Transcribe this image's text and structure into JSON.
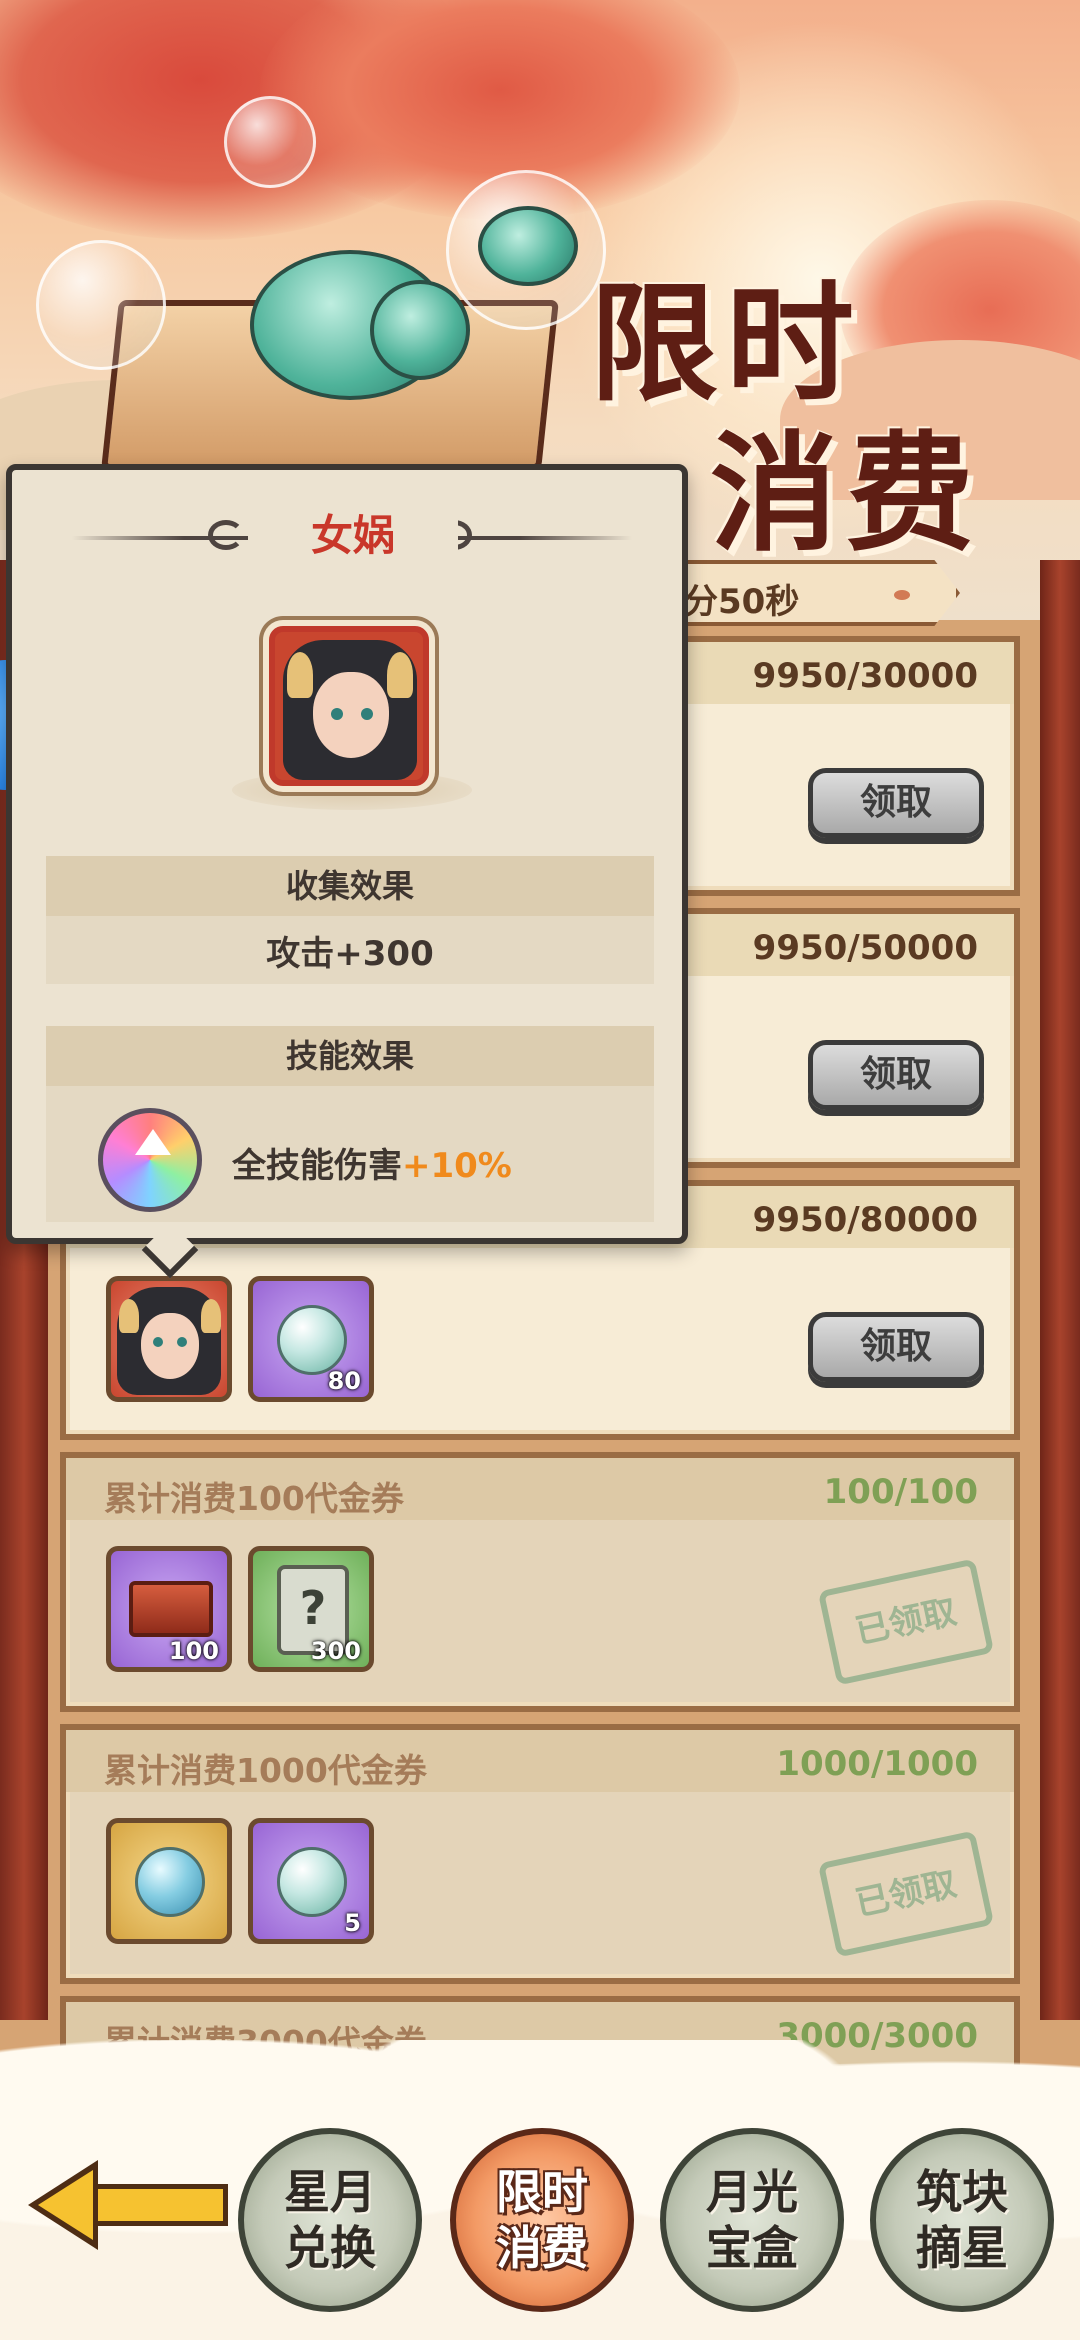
{
  "event": {
    "title_line1": "限时",
    "title_line2": "消费",
    "timer_text": "分50秒"
  },
  "popup": {
    "hero_name": "女娲",
    "collect_section_title": "收集效果",
    "collect_effect": "攻击+300",
    "skill_section_title": "技能效果",
    "skill_effect_text": "全技能伤害",
    "skill_effect_bonus": "+10%"
  },
  "rewards": [
    {
      "progress": "9950/30000",
      "button": "领取"
    },
    {
      "progress": "9950/50000",
      "button": "领取"
    },
    {
      "progress": "9950/80000",
      "button": "领取",
      "items": [
        {
          "icon": "hero-nuwa-icon",
          "count": ""
        },
        {
          "icon": "pearl-icon",
          "count": "80"
        }
      ]
    },
    {
      "title": "累计消费100代金券",
      "progress": "100/100",
      "status": "已领取",
      "items": [
        {
          "icon": "chest-icon",
          "count": "100"
        },
        {
          "icon": "mystery-scroll-icon",
          "count": "300"
        }
      ]
    },
    {
      "title": "累计消费1000代金券",
      "progress": "1000/1000",
      "status": "已领取",
      "items": [
        {
          "icon": "blue-orb-icon",
          "count": ""
        },
        {
          "icon": "pearl-icon",
          "count": "5"
        }
      ]
    },
    {
      "title": "累计消费3000代金券",
      "progress": "3000/3000"
    }
  ],
  "nav": {
    "back": "back-arrow-icon",
    "tabs": [
      {
        "line1": "星月",
        "line2": "兑换"
      },
      {
        "line1": "限时",
        "line2": "消费",
        "active": true
      },
      {
        "line1": "月光",
        "line2": "宝盒"
      },
      {
        "line1": "筑块",
        "line2": "摘星"
      }
    ]
  },
  "colors": {
    "accent_red": "#c9372a",
    "bonus_orange": "#f08a1c",
    "claimed_green": "#7fa055"
  }
}
